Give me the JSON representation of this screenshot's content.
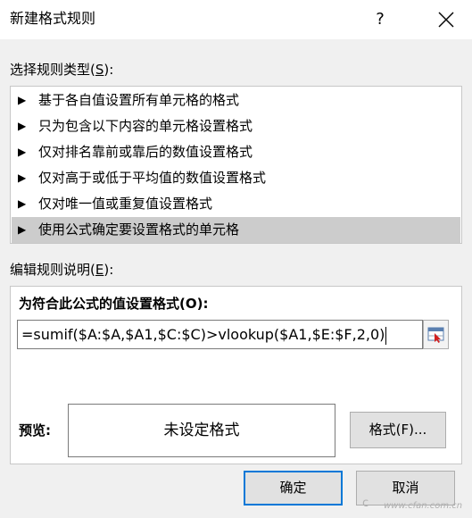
{
  "dialog": {
    "title": "新建格式规则",
    "help_symbol": "?",
    "close_symbol": "×"
  },
  "rule_type": {
    "label_before": "选择规则类型(",
    "label_key": "S",
    "label_after": "):",
    "items": [
      {
        "label": "基于各自值设置所有单元格的格式",
        "selected": false
      },
      {
        "label": "只为包含以下内容的单元格设置格式",
        "selected": false
      },
      {
        "label": "仅对排名靠前或靠后的数值设置格式",
        "selected": false
      },
      {
        "label": "仅对高于或低于平均值的数值设置格式",
        "selected": false
      },
      {
        "label": "仅对唯一值或重复值设置格式",
        "selected": false
      },
      {
        "label": "使用公式确定要设置格式的单元格",
        "selected": true
      }
    ],
    "arrow": "▶"
  },
  "description": {
    "label_before": "编辑规则说明(",
    "label_key": "E",
    "label_after": "):",
    "formula_heading": "为符合此公式的值设置格式(O):",
    "formula_value": "=sumif($A:$A,$A1,$C:$C)>vlookup($A1,$E:$F,2,0)",
    "preview_label": "预览:",
    "preview_text": "未设定格式",
    "format_button": "格式(F)..."
  },
  "buttons": {
    "ok": "确定",
    "cancel": "取消"
  },
  "watermark": {
    "symbol": "c",
    "url": "www.cfan.com.cn"
  },
  "colors": {
    "selected_row": "#cccccc",
    "default_button_border": "#0078d7",
    "dialog_bg": "#f0f0f0"
  }
}
